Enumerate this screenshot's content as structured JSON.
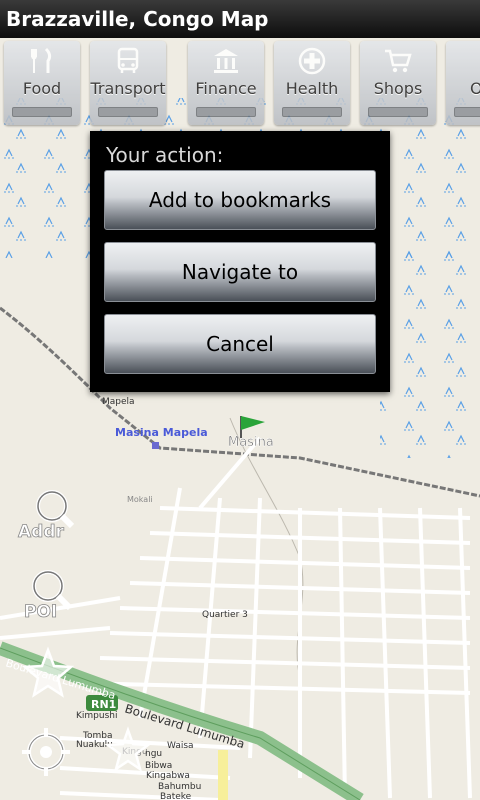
{
  "app": {
    "title": "Brazzaville, Congo Map"
  },
  "categories": [
    {
      "label": "Food",
      "icon": "fork-knife-icon"
    },
    {
      "label": "Transport",
      "icon": "bus-icon"
    },
    {
      "label": "Finance",
      "icon": "bank-icon"
    },
    {
      "label": "Health",
      "icon": "medical-cross-icon"
    },
    {
      "label": "Shops",
      "icon": "shopping-cart-icon"
    },
    {
      "label": "O",
      "icon": "partial-category-icon"
    }
  ],
  "dialog": {
    "heading": "Your action:",
    "buttons": [
      "Add to bookmarks",
      "Navigate to",
      "Cancel"
    ]
  },
  "map_labels": {
    "mapela": "Mapela",
    "masina_mapela": "Masina Mapela",
    "masina": "Masina",
    "mokali": "Mokali",
    "quartier3": "Quartier 3",
    "boulevard_upper": "Boulevard Lumumba",
    "boulevard_lower": "Boulevard Lumumba",
    "rn1": "RN1",
    "kimpushi": "Kimpushi",
    "tomba": "Tomba",
    "nuakulu": "Nuakulu",
    "waisa": "Waisa",
    "kingu": "Kingu",
    "ngu": "ngu",
    "bibwa": "Bibwa",
    "kingabwa": "Kingabwa",
    "bahumbu": "Bahumbu",
    "bateke": "Bateke"
  },
  "tools": {
    "addr": "Addr",
    "poi": "POI"
  },
  "colors": {
    "map_background": "#efece3",
    "water_marsh": "#5aa0e6",
    "road_main": "#9ac59a",
    "road_yellow": "#f7ef9a",
    "flag": "#2aa43a"
  }
}
